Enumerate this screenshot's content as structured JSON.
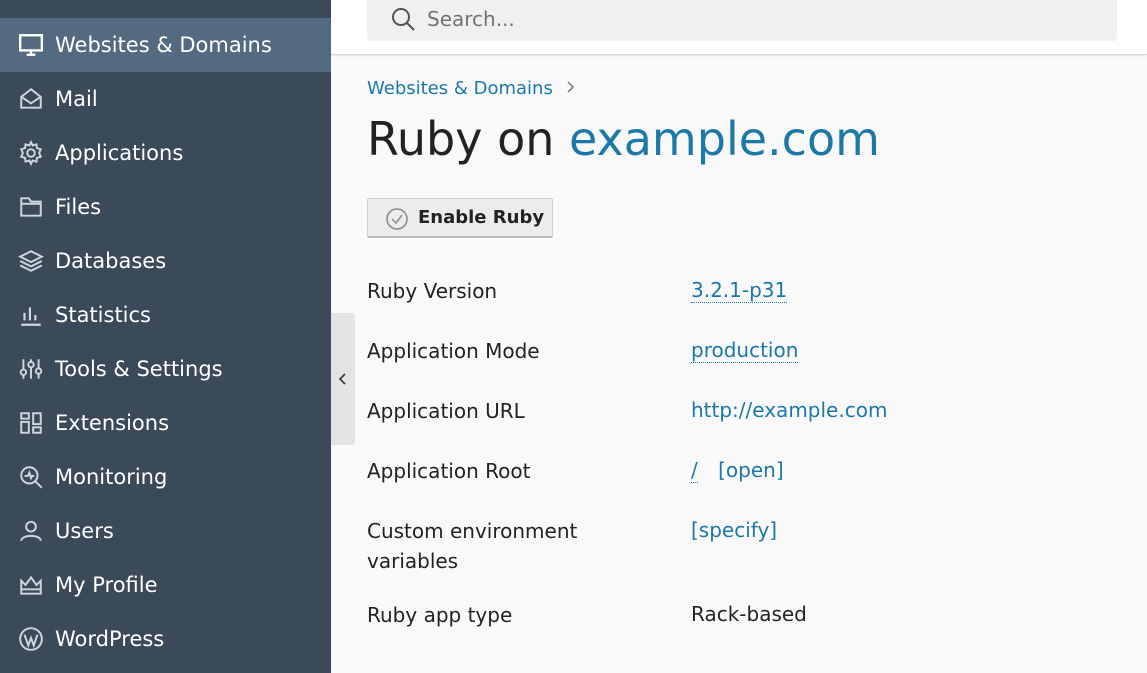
{
  "sidebar": {
    "items": [
      {
        "label": "Websites & Domains",
        "icon": "monitor-icon",
        "active": true
      },
      {
        "label": "Mail",
        "icon": "mail-icon"
      },
      {
        "label": "Applications",
        "icon": "gear-icon"
      },
      {
        "label": "Files",
        "icon": "folder-icon"
      },
      {
        "label": "Databases",
        "icon": "database-layers-icon"
      },
      {
        "label": "Statistics",
        "icon": "bar-chart-icon"
      },
      {
        "label": "Tools & Settings",
        "icon": "sliders-icon"
      },
      {
        "label": "Extensions",
        "icon": "extensions-icon"
      },
      {
        "label": "Monitoring",
        "icon": "monitoring-icon"
      },
      {
        "label": "Users",
        "icon": "user-icon"
      },
      {
        "label": "My Profile",
        "icon": "crown-icon"
      },
      {
        "label": "WordPress",
        "icon": "wordpress-icon"
      }
    ]
  },
  "search": {
    "placeholder": "Search..."
  },
  "breadcrumb": {
    "items": [
      "Websites & Domains"
    ]
  },
  "title": {
    "prefix": "Ruby on",
    "domain": "example.com"
  },
  "toolbar": {
    "enable_label": "Enable Ruby"
  },
  "settings": {
    "ruby_version": {
      "label": "Ruby Version",
      "value": "3.2.1-p31"
    },
    "app_mode": {
      "label": "Application Mode",
      "value": "production"
    },
    "app_url": {
      "label": "Application URL",
      "value": "http://example.com"
    },
    "app_root": {
      "label": "Application Root",
      "value": "/",
      "open_label": "[open]"
    },
    "env_vars": {
      "label": "Custom environment variables",
      "value": "[specify]"
    },
    "app_type": {
      "label": "Ruby app type",
      "value": "Rack-based"
    }
  },
  "colors": {
    "sidebar": "#3b4a59",
    "sidebar_active": "#546a80",
    "link": "#1b78a8"
  }
}
